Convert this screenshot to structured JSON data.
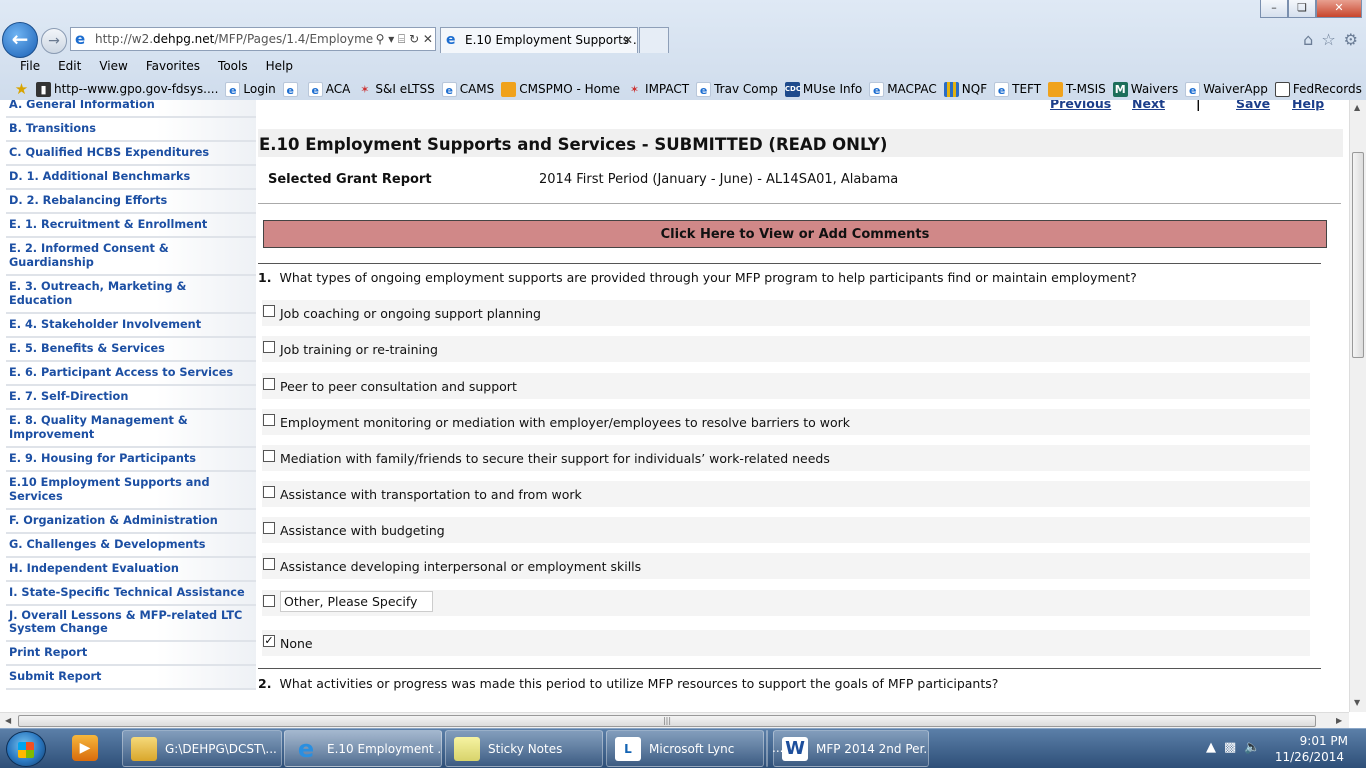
{
  "browser": {
    "url_prefix": "http://w2.",
    "url_domain": "dehpg.net",
    "url_path": "/MFP/Pages/1.4/Employme",
    "tab_title": "E.10 Employment Supports ...",
    "menu": [
      "File",
      "Edit",
      "View",
      "Favorites",
      "Tools",
      "Help"
    ],
    "favorites": [
      {
        "label": "http--www.gpo.gov-fdsys....",
        "icon": "ic-dark"
      },
      {
        "label": "Login",
        "icon": "ic-ie"
      },
      {
        "label": "",
        "icon": "ic-ie"
      },
      {
        "label": "ACA",
        "icon": "ic-ie"
      },
      {
        "label": "S&I eLTSS",
        "icon": "ic-red"
      },
      {
        "label": "CAMS",
        "icon": "ic-ie"
      },
      {
        "label": "CMSPMO - Home",
        "icon": "ic-orange"
      },
      {
        "label": "IMPACT",
        "icon": "ic-red"
      },
      {
        "label": "Trav Comp",
        "icon": "ic-ie"
      },
      {
        "label": "MUse Info",
        "icon": "ic-cdc"
      },
      {
        "label": "MACPAC",
        "icon": "ic-ie"
      },
      {
        "label": "NQF",
        "icon": "ic-grid"
      },
      {
        "label": "TEFT",
        "icon": "ic-ie"
      },
      {
        "label": "T-MSIS",
        "icon": "ic-orange"
      },
      {
        "label": "Waivers",
        "icon": "ic-m"
      },
      {
        "label": "WaiverApp",
        "icon": "ic-ie"
      },
      {
        "label": "FedRecords",
        "icon": "ic-rec"
      }
    ]
  },
  "sidebar": {
    "items": [
      "A. General Information",
      "B. Transitions",
      "C. Qualified HCBS Expenditures",
      "D. 1. Additional Benchmarks",
      "D. 2. Rebalancing Efforts",
      "E. 1. Recruitment & Enrollment",
      "E. 2. Informed Consent & Guardianship",
      "E. 3. Outreach, Marketing & Education",
      "E. 4. Stakeholder Involvement",
      "E. 5. Benefits & Services",
      "E. 6. Participant Access to Services",
      "E. 7. Self-Direction",
      "E. 8. Quality Management & Improvement",
      "E. 9. Housing for Participants",
      "E.10 Employment Supports and Services",
      "F. Organization & Administration",
      "G. Challenges & Developments",
      "H. Independent Evaluation",
      "I. State-Specific Technical Assistance",
      "J. Overall Lessons & MFP-related LTC System Change",
      "Print Report",
      "Submit Report"
    ]
  },
  "toplinks": {
    "previous": "Previous",
    "next": "Next",
    "sep": "|",
    "save": "Save",
    "help": "Help"
  },
  "page": {
    "title": "E.10 Employment Supports and Services - SUBMITTED (READ ONLY)",
    "grant_label": "Selected Grant Report",
    "grant_value": "2014 First Period (January - June) - AL14SA01, Alabama",
    "comments_button": "Click Here to View or Add Comments",
    "q1_num": "1.",
    "q1_text": "What types of ongoing employment supports are provided through your MFP program to help participants find or maintain employment?",
    "options": [
      {
        "label": "Job coaching or ongoing support planning",
        "checked": false
      },
      {
        "label": "Job training or re-training",
        "checked": false
      },
      {
        "label": "Peer to peer consultation and support",
        "checked": false
      },
      {
        "label": "Employment monitoring or mediation with employer/employees to resolve barriers to work",
        "checked": false
      },
      {
        "label": "Mediation with family/friends to secure their support for individuals’ work-related needs",
        "checked": false
      },
      {
        "label": "Assistance with transportation to and from work",
        "checked": false
      },
      {
        "label": "Assistance with budgeting",
        "checked": false
      },
      {
        "label": "Assistance developing interpersonal or employment skills",
        "checked": false
      }
    ],
    "other_value": "Other, Please Specify",
    "other_checked": false,
    "none_label": "None",
    "none_checked": true,
    "q2_num": "2.",
    "q2_text": "What activities or progress was made this period to utilize MFP resources to support the goals of MFP participants?"
  },
  "taskbar": {
    "tasks": [
      "G:\\DEHPG\\DCST\\...",
      "E.10 Employment ...",
      "Sticky Notes",
      "Microsoft Lync",
      "...",
      "MFP 2014 2nd Per..."
    ],
    "time": "9:01 PM",
    "date": "11/26/2014"
  }
}
